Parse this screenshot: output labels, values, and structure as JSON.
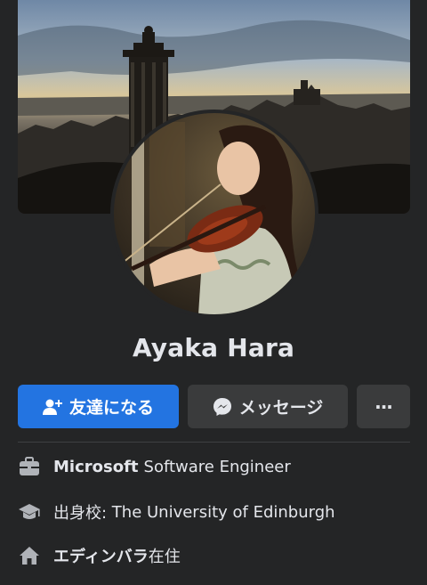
{
  "profile": {
    "name": "Ayaka Hara"
  },
  "actions": {
    "add_friend_label": "友達になる",
    "message_label": "メッセージ",
    "more_label": "···"
  },
  "intro": {
    "work": {
      "company": "Microsoft",
      "title": "Software Engineer",
      "icon": "briefcase-icon"
    },
    "education": {
      "prefix": "出身校: ",
      "school": "The University of Edinburgh",
      "icon": "graduation-cap-icon"
    },
    "residence": {
      "place": "エディンバラ",
      "suffix": "在住",
      "icon": "home-icon"
    }
  },
  "colors": {
    "background": "#242526",
    "primary_button": "#2374e1",
    "secondary_button": "#3a3b3c",
    "text": "#e4e6eb"
  }
}
